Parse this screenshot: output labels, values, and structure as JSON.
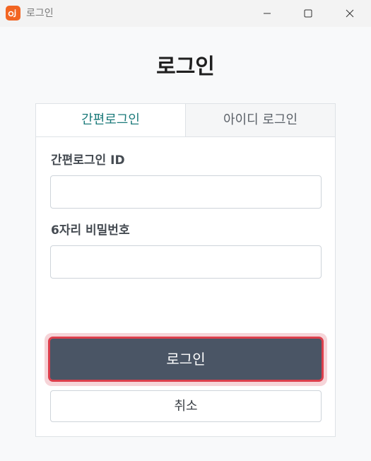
{
  "window": {
    "title": "로그인",
    "app_icon": "app-logo-icon",
    "controls": [
      "minimize-icon",
      "maximize-icon",
      "close-icon"
    ]
  },
  "page": {
    "title": "로그인"
  },
  "tabs": [
    {
      "label": "간편로그인",
      "active": true
    },
    {
      "label": "아이디 로그인",
      "active": false
    }
  ],
  "form": {
    "id_label": "간편로그인 ID",
    "id_value": "",
    "pw_label": "6자리 비밀번호",
    "pw_value": ""
  },
  "buttons": {
    "login_label": "로그인",
    "cancel_label": "취소"
  },
  "colors": {
    "accent_tab": "#1b7a7a",
    "login_button": "#4a5565",
    "focus_border": "#dc3f4c",
    "app_icon_bg": "#f26522"
  }
}
